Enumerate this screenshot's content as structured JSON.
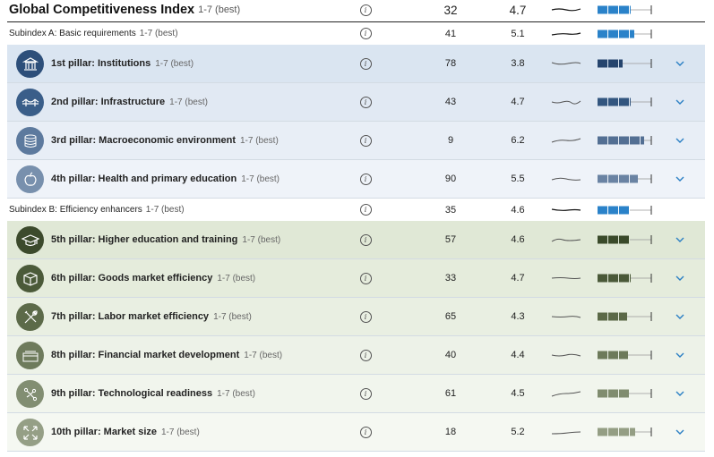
{
  "header": {
    "title": "Global Competitiveness Index",
    "range": "1-7 (best)",
    "rank": "32",
    "score": "4.7",
    "score_value": 4.7,
    "color": "#2a82c9"
  },
  "subindex_a": {
    "title": "Subindex A: Basic requirements",
    "range": "1-7 (best)",
    "rank": "41",
    "score": "5.1",
    "score_value": 5.1,
    "color": "#2a82c9"
  },
  "subindex_b": {
    "title": "Subindex B: Efficiency enhancers",
    "range": "1-7 (best)",
    "rank": "35",
    "score": "4.6",
    "score_value": 4.6,
    "color": "#2a82c9"
  },
  "pillars": [
    {
      "name": "1st pillar: Institutions",
      "range": "1-7 (best)",
      "rank": "78",
      "score": "3.8",
      "score_value": 3.8,
      "icon": "institution-building-icon",
      "bg": "#dae5f1",
      "circle": "#2d4f7a",
      "bar": "#25446d"
    },
    {
      "name": "2nd pillar: Infrastructure",
      "range": "1-7 (best)",
      "rank": "43",
      "score": "4.7",
      "score_value": 4.7,
      "icon": "bridge-icon",
      "bg": "#e1e9f3",
      "circle": "#3a5e89",
      "bar": "#33567f"
    },
    {
      "name": "3rd pillar: Macroeconomic environment",
      "range": "1-7 (best)",
      "rank": "9",
      "score": "6.2",
      "score_value": 6.2,
      "icon": "coins-stack-icon",
      "bg": "#e8eef6",
      "circle": "#5d7a9e",
      "bar": "#536f93"
    },
    {
      "name": "4th pillar: Health and primary education",
      "range": "1-7 (best)",
      "rank": "90",
      "score": "5.5",
      "score_value": 5.5,
      "icon": "apple-icon",
      "bg": "#eff3f9",
      "circle": "#7890ad",
      "bar": "#6a83a3"
    },
    {
      "name": "5th pillar: Higher education and training",
      "range": "1-7 (best)",
      "rank": "57",
      "score": "4.6",
      "score_value": 4.6,
      "icon": "graduation-cap-icon",
      "bg": "#e0e8d6",
      "circle": "#3c4a2c",
      "bar": "#3a4a2a"
    },
    {
      "name": "6th pillar: Goods market efficiency",
      "range": "1-7 (best)",
      "rank": "33",
      "score": "4.7",
      "score_value": 4.7,
      "icon": "box-icon",
      "bg": "#e5ecdc",
      "circle": "#4b5a39",
      "bar": "#4a5938"
    },
    {
      "name": "7th pillar: Labor market efficiency",
      "range": "1-7 (best)",
      "rank": "65",
      "score": "4.3",
      "score_value": 4.3,
      "icon": "tools-icon",
      "bg": "#e9efe2",
      "circle": "#5c6a49",
      "bar": "#5b6947"
    },
    {
      "name": "8th pillar: Financial market development",
      "range": "1-7 (best)",
      "rank": "40",
      "score": "4.4",
      "score_value": 4.4,
      "icon": "cash-icon",
      "bg": "#edf2e8",
      "circle": "#6e7b5c",
      "bar": "#6d7a5a"
    },
    {
      "name": "9th pillar: Technological readiness",
      "range": "1-7 (best)",
      "rank": "61",
      "score": "4.5",
      "score_value": 4.5,
      "icon": "circuit-icon",
      "bg": "#f1f5ed",
      "circle": "#828e72",
      "bar": "#808c6f"
    },
    {
      "name": "10th pillar: Market size",
      "range": "1-7 (best)",
      "rank": "18",
      "score": "5.2",
      "score_value": 5.2,
      "icon": "expand-arrows-icon",
      "bg": "#f5f8f2",
      "circle": "#959f86",
      "bar": "#949e84"
    }
  ],
  "score_scale": {
    "min": 1,
    "max": 7
  }
}
